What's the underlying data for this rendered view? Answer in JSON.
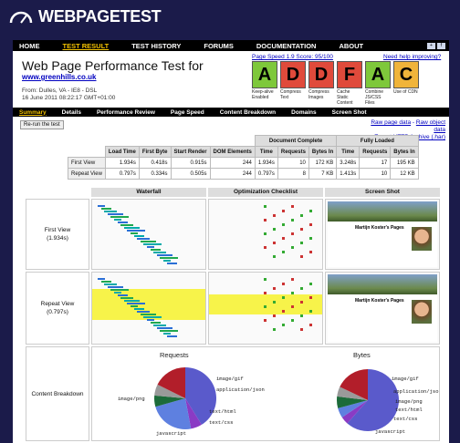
{
  "app": {
    "logo_text": "WEBPAGETEST"
  },
  "nav": {
    "items": [
      "HOME",
      "TEST RESULT",
      "TEST HISTORY",
      "FORUMS",
      "DOCUMENTATION",
      "ABOUT"
    ],
    "active": "TEST RESULT"
  },
  "header": {
    "title": "Web Page Performance Test for",
    "url": "www.greenhills.co.uk",
    "from": "From: Dulles, VA - IE8 - DSL",
    "date": "16 June 2011 08:22:17 GMT+01:00",
    "pagespeed": "Page Speed 1.9 Score: 95/100",
    "help": "Need help improving?"
  },
  "grades": [
    {
      "letter": "A",
      "color": "#7ec83b",
      "label": "Keep-alive Enabled"
    },
    {
      "letter": "D",
      "color": "#e04a3b",
      "label": "Compress Text"
    },
    {
      "letter": "D",
      "color": "#e04a3b",
      "label": "Compress Images"
    },
    {
      "letter": "F",
      "color": "#e04a3b",
      "label": "Cache Static Content"
    },
    {
      "letter": "A",
      "color": "#7ec83b",
      "label": "Combine JS/CSS Files"
    },
    {
      "letter": "C",
      "color": "#f0b43a",
      "label": "Use of CDN"
    }
  ],
  "subnav": {
    "items": [
      "Summary",
      "Details",
      "Performance Review",
      "Page Speed",
      "Content Breakdown",
      "Domains",
      "Screen Shot"
    ],
    "active": "Summary"
  },
  "actions": {
    "rerun": "Re-run the test",
    "raw_page": "Raw page data",
    "raw_object": "Raw object data",
    "export": "Export HTTP Archive (.har)"
  },
  "results": {
    "group_headers": [
      "Document Complete",
      "Fully Loaded"
    ],
    "columns": [
      "Load Time",
      "First Byte",
      "Start Render",
      "DOM Elements",
      "Time",
      "Requests",
      "Bytes In",
      "Time",
      "Requests",
      "Bytes In"
    ],
    "rows": [
      {
        "label": "First View",
        "values": [
          "1.934s",
          "0.418s",
          "0.915s",
          "244",
          "1.934s",
          "10",
          "172 KB",
          "3.248s",
          "17",
          "195 KB"
        ]
      },
      {
        "label": "Repeat View",
        "values": [
          "0.797s",
          "0.334s",
          "0.505s",
          "244",
          "0.797s",
          "8",
          "7 KB",
          "1.413s",
          "10",
          "12 KB"
        ]
      }
    ]
  },
  "grid": {
    "columns": [
      "Waterfall",
      "Optimization Checklist",
      "Screen Shot"
    ],
    "rows": [
      {
        "label": "First View",
        "sub": "(1.934s)"
      },
      {
        "label": "Repeat View",
        "sub": "(0.797s)"
      },
      {
        "label": "Content Breakdown",
        "sub": ""
      }
    ],
    "screenshot_title": "Martijn Koster's Pages"
  },
  "breakdown": {
    "requests_title": "Requests",
    "bytes_title": "Bytes",
    "labels": [
      "image/gif",
      "application/json",
      "image/png",
      "text/html",
      "text/css",
      "javascript"
    ],
    "colors": {
      "image/gif": "#5a5acb",
      "application/json": "#8a3bc4",
      "image/png": "#5e80e0",
      "text/html": "#1c6b3a",
      "text/css": "#9a9a9a",
      "javascript": "#b21e2a"
    }
  },
  "chart_data": [
    {
      "type": "pie",
      "title": "Requests",
      "labels": [
        "image/gif",
        "application/json",
        "image/png",
        "text/html",
        "text/css",
        "javascript"
      ],
      "values": [
        7,
        1,
        4,
        1,
        1,
        3
      ]
    },
    {
      "type": "pie",
      "title": "Bytes",
      "labels": [
        "image/gif",
        "application/json",
        "image/png",
        "text/html",
        "text/css",
        "javascript"
      ],
      "values": [
        120,
        8,
        10,
        12,
        10,
        35
      ]
    }
  ]
}
